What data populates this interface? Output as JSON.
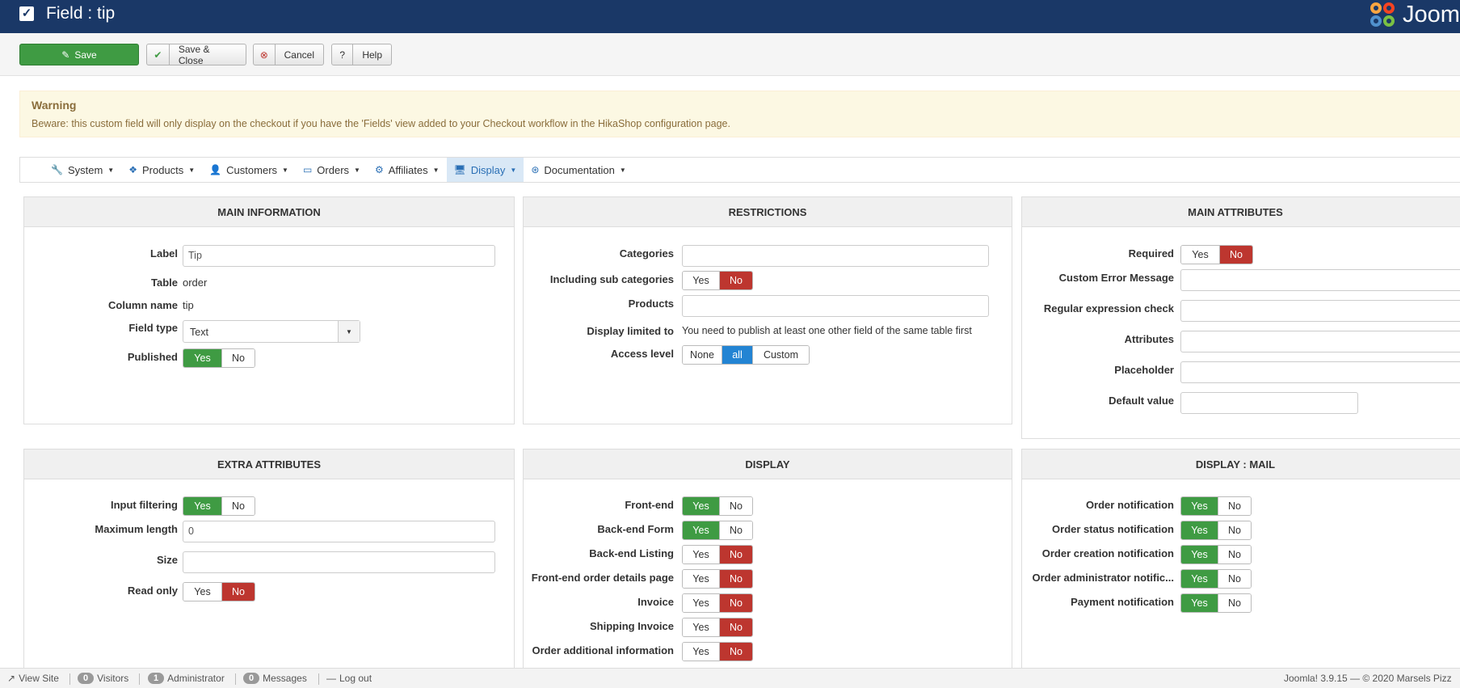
{
  "header": {
    "title": "Field : tip",
    "logo_text": "Jooml"
  },
  "toolbar": {
    "save": "Save",
    "save_close": "Save & Close",
    "cancel": "Cancel",
    "help": "Help"
  },
  "alert": {
    "title": "Warning",
    "text": "Beware: this custom field will only display on the checkout if you have the 'Fields' view added to your Checkout workflow in the HikaShop configuration page."
  },
  "menu": [
    "System",
    "Products",
    "Customers",
    "Orders",
    "Affiliates",
    "Display",
    "Documentation"
  ],
  "main_info": {
    "title": "MAIN INFORMATION",
    "label_label": "Label",
    "label_value": "Tip",
    "table_label": "Table",
    "table_value": "order",
    "column_label": "Column name",
    "column_value": "tip",
    "fieldtype_label": "Field type",
    "fieldtype_value": "Text",
    "published_label": "Published"
  },
  "restrictions": {
    "title": "RESTRICTIONS",
    "categories": "Categories",
    "subcats": "Including sub categories",
    "products": "Products",
    "display_limited": "Display limited to",
    "display_limited_value": "You need to publish at least one other field of the same table first",
    "access": "Access level",
    "access_none": "None",
    "access_all": "all",
    "access_custom": "Custom"
  },
  "main_attr": {
    "title": "MAIN ATTRIBUTES",
    "required": "Required",
    "custom_error": "Custom Error Message",
    "regex": "Regular expression check",
    "attributes": "Attributes",
    "placeholder": "Placeholder",
    "default": "Default value"
  },
  "extra": {
    "title": "EXTRA ATTRIBUTES",
    "input_filtering": "Input filtering",
    "max_length": "Maximum length",
    "max_length_value": "0",
    "size": "Size",
    "read_only": "Read only"
  },
  "display": {
    "title": "DISPLAY",
    "rows": [
      "Front-end",
      "Back-end Form",
      "Back-end Listing",
      "Front-end order details page",
      "Invoice",
      "Shipping Invoice",
      "Order additional information"
    ]
  },
  "display_mail": {
    "title": "DISPLAY : MAIL",
    "rows": [
      "Order notification",
      "Order status notification",
      "Order creation notification",
      "Order administrator notific...",
      "Payment notification"
    ]
  },
  "toggle": {
    "yes": "Yes",
    "no": "No"
  },
  "footer": {
    "view_site": "View Site",
    "visitors_count": "0",
    "visitors": "Visitors",
    "admin_count": "1",
    "admin": "Administrator",
    "messages_count": "0",
    "messages": "Messages",
    "logout": "Log out",
    "version": "Joomla! 3.9.15  —  © 2020 Marsels Pizz"
  }
}
